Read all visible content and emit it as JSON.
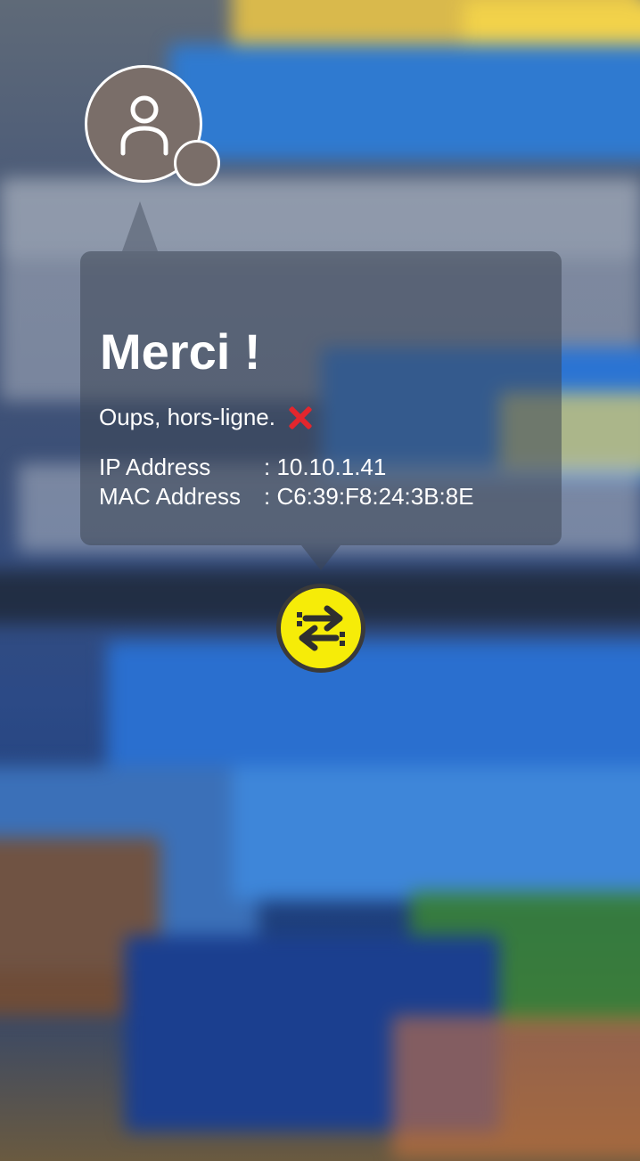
{
  "header": {
    "avatar_icon": "user-icon",
    "avatar_color": "#7a6e69"
  },
  "card": {
    "title": "Merci !",
    "status_text": "Oups, hors-ligne.",
    "status_icon": "cross-mark-icon",
    "status_color": "#e3262d",
    "ip_label": "IP Address",
    "ip_value": ": 10.10.1.41",
    "mac_label": "MAC Address",
    "mac_value": ": C6:39:F8:24:3B:8E"
  },
  "actions": {
    "swap_icon": "swap-arrows-icon",
    "swap_color": "#f6ec08"
  }
}
